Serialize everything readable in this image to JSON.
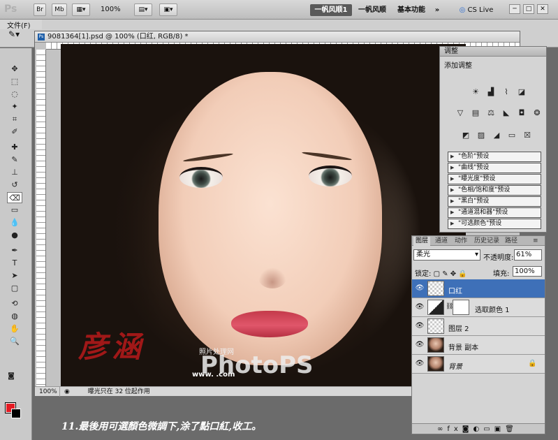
{
  "app": {
    "logo": "Ps",
    "zoom": "100%",
    "workspaces": [
      "一帆风顺1",
      "一帆风顺",
      "基本功能"
    ],
    "more": "»",
    "cslive": "CS Live",
    "window_controls": [
      "─",
      "□",
      "✕"
    ],
    "toolbar_buttons": [
      "Br",
      "Mb"
    ]
  },
  "menu": {
    "file_label": "文件(F)"
  },
  "document": {
    "title": "9081364[1].psd @ 100% (口红, RGB/8) *",
    "zoom_status": "100%",
    "status_text": "曝光只在 32 位起作用",
    "watermark_cn": "彦涵",
    "watermark_site_cn": "照片处理网",
    "watermark_logo": "PhotoPS",
    "watermark_url": "www.              .com"
  },
  "adjustments": {
    "title": "调整",
    "subtitle": "添加调整",
    "presets": [
      "\"色阶\"预设",
      "\"曲线\"预设",
      "\"曝光度\"预设",
      "\"色相/饱和度\"预设",
      "\"黑白\"预设",
      "\"通道混和器\"预设",
      "\"可选颜色\"预设"
    ]
  },
  "layers_panel": {
    "tabs": [
      "图层",
      "通道",
      "动作",
      "历史记录",
      "路径"
    ],
    "blend_mode": "柔光",
    "opacity_label": "不透明度:",
    "opacity_value": "61%",
    "lock_label": "锁定:",
    "fill_label": "填充:",
    "fill_value": "100%",
    "layers": [
      {
        "name": "口红"
      },
      {
        "name": "选取颜色 1"
      },
      {
        "name": "图层 2"
      },
      {
        "name": "背景 副本"
      },
      {
        "name": "背景"
      }
    ]
  },
  "caption": "11.最後用可選顏色微調下,涂了點口紅,收工。",
  "colors": {
    "foreground": "#e41b23",
    "background": "#000000",
    "selected_layer": "#3e70b8"
  }
}
